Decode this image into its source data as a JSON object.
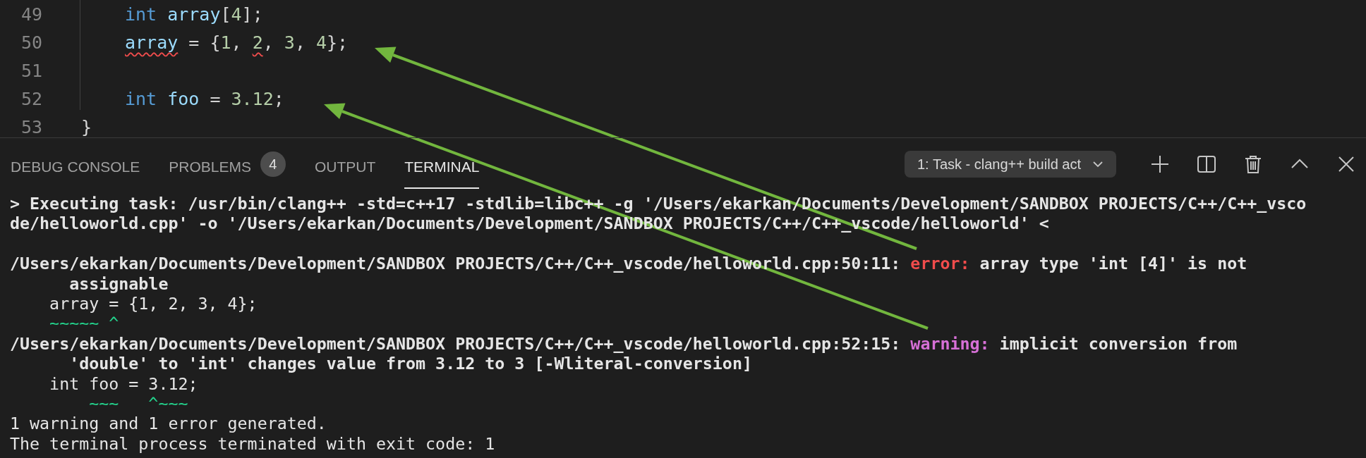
{
  "editor": {
    "inner_lines": [
      {
        "number": "49",
        "tokens": [
          {
            "text": "int",
            "kind": "keyword"
          },
          {
            "text": "array",
            "kind": "variable"
          },
          {
            "text": "[",
            "kind": "punct"
          },
          {
            "text": "4",
            "kind": "number"
          },
          {
            "text": "];",
            "kind": "punct"
          }
        ]
      },
      {
        "number": "50",
        "tokens": [
          {
            "text": "array",
            "kind": "variable",
            "squiggle": true
          },
          {
            "text": " = {",
            "kind": "punct"
          },
          {
            "text": "1",
            "kind": "number"
          },
          {
            "text": ", ",
            "kind": "punct"
          },
          {
            "text": "2",
            "kind": "number",
            "squiggle": true
          },
          {
            "text": ", ",
            "kind": "punct"
          },
          {
            "text": "3",
            "kind": "number"
          },
          {
            "text": ", ",
            "kind": "punct"
          },
          {
            "text": "4",
            "kind": "number"
          },
          {
            "text": "};",
            "kind": "punct"
          }
        ]
      },
      {
        "number": "51"
      },
      {
        "number": "52",
        "tokens": [
          {
            "text": "int",
            "kind": "keyword"
          },
          {
            "text": "foo",
            "kind": "variable"
          },
          {
            "text": " = ",
            "kind": "punct"
          },
          {
            "text": "3.12",
            "kind": "number"
          },
          {
            "text": ";",
            "kind": "punct"
          }
        ]
      }
    ],
    "closing_line": {
      "number": "53",
      "tokens": [
        {
          "text": "}",
          "kind": "punct"
        }
      ]
    }
  },
  "panel": {
    "tabs": [
      {
        "label": "DEBUG CONSOLE",
        "selected": false
      },
      {
        "label": "PROBLEMS",
        "selected": false,
        "badge": "4"
      },
      {
        "label": "OUTPUT",
        "selected": false
      },
      {
        "label": "TERMINAL",
        "selected": true
      }
    ],
    "terminal_select": "1: Task - clang++ build act",
    "terminal": [
      {
        "kind": "text",
        "segments": [
          {
            "text": "> Executing task: /usr/bin/clang++ -std=c++17 -stdlib=libc++ -g '/Users/ekarkan/Documents/Development/SANDBOX PROJECTS/C++/C++_vsco",
            "kind": "strong"
          }
        ]
      },
      {
        "kind": "text",
        "segments": [
          {
            "text": "de/helloworld.cpp' -o '/Users/ekarkan/Documents/Development/SANDBOX PROJECTS/C++/C++_vscode/helloworld' <",
            "kind": "strong"
          }
        ]
      },
      {
        "kind": "blank"
      },
      {
        "kind": "text",
        "segments": [
          {
            "text": "/Users/ekarkan/Documents/Development/SANDBOX PROJECTS/C++/C++_vscode/helloworld.cpp:50:11: ",
            "kind": "strong"
          },
          {
            "text": "error:",
            "kind": "error"
          },
          {
            "text": " array type 'int [4]' is not",
            "kind": "strong"
          }
        ]
      },
      {
        "kind": "text",
        "segments": [
          {
            "text": "      assignable",
            "kind": "strong"
          }
        ]
      },
      {
        "kind": "text",
        "segments": [
          {
            "text": "    array = {1, 2, 3, 4};",
            "kind": "normal"
          }
        ]
      },
      {
        "kind": "marks",
        "segments": [
          {
            "text": "    ~~~~~ ^",
            "kind": "marker"
          }
        ]
      },
      {
        "kind": "text",
        "segments": [
          {
            "text": "/Users/ekarkan/Documents/Development/SANDBOX PROJECTS/C++/C++_vscode/helloworld.cpp:52:15: ",
            "kind": "strong"
          },
          {
            "text": "warning:",
            "kind": "warning"
          },
          {
            "text": " implicit conversion from",
            "kind": "strong"
          }
        ]
      },
      {
        "kind": "text",
        "segments": [
          {
            "text": "      'double' to 'int' changes value from 3.12 to 3 [-Wliteral-conversion]",
            "kind": "strong"
          }
        ]
      },
      {
        "kind": "text",
        "segments": [
          {
            "text": "    int foo = 3.12;",
            "kind": "normal"
          }
        ]
      },
      {
        "kind": "marks",
        "segments": [
          {
            "text": "        ~~~   ^~~~",
            "kind": "marker"
          }
        ]
      },
      {
        "kind": "text",
        "segments": [
          {
            "text": "1 warning and 1 error generated.",
            "kind": "normal"
          }
        ]
      },
      {
        "kind": "text",
        "segments": [
          {
            "text": "The terminal process terminated with exit code: 1",
            "kind": "normal"
          }
        ]
      }
    ]
  }
}
